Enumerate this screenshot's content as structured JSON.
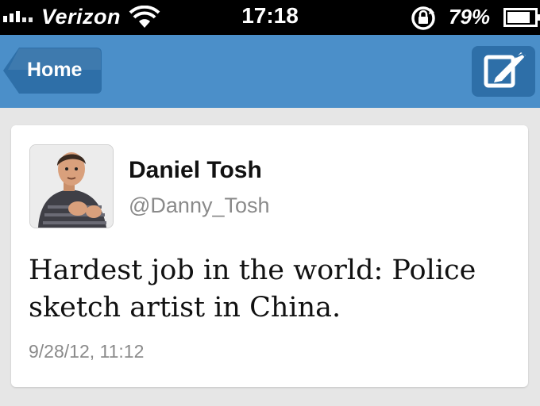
{
  "status_bar": {
    "carrier": "Verizon",
    "time": "17:18",
    "battery_percent": "79%"
  },
  "nav_bar": {
    "back_label": "Home",
    "compose_icon": "compose-icon"
  },
  "tweet": {
    "display_name": "Daniel Tosh",
    "handle": "@Danny_Tosh",
    "text": "Hardest job in the world: Police sketch artist in China.",
    "timestamp": "9/28/12, 11:12"
  },
  "colors": {
    "nav_bar": "#4b8fc9",
    "back_button": "#2e6fa8",
    "background": "#e6e6e6"
  }
}
